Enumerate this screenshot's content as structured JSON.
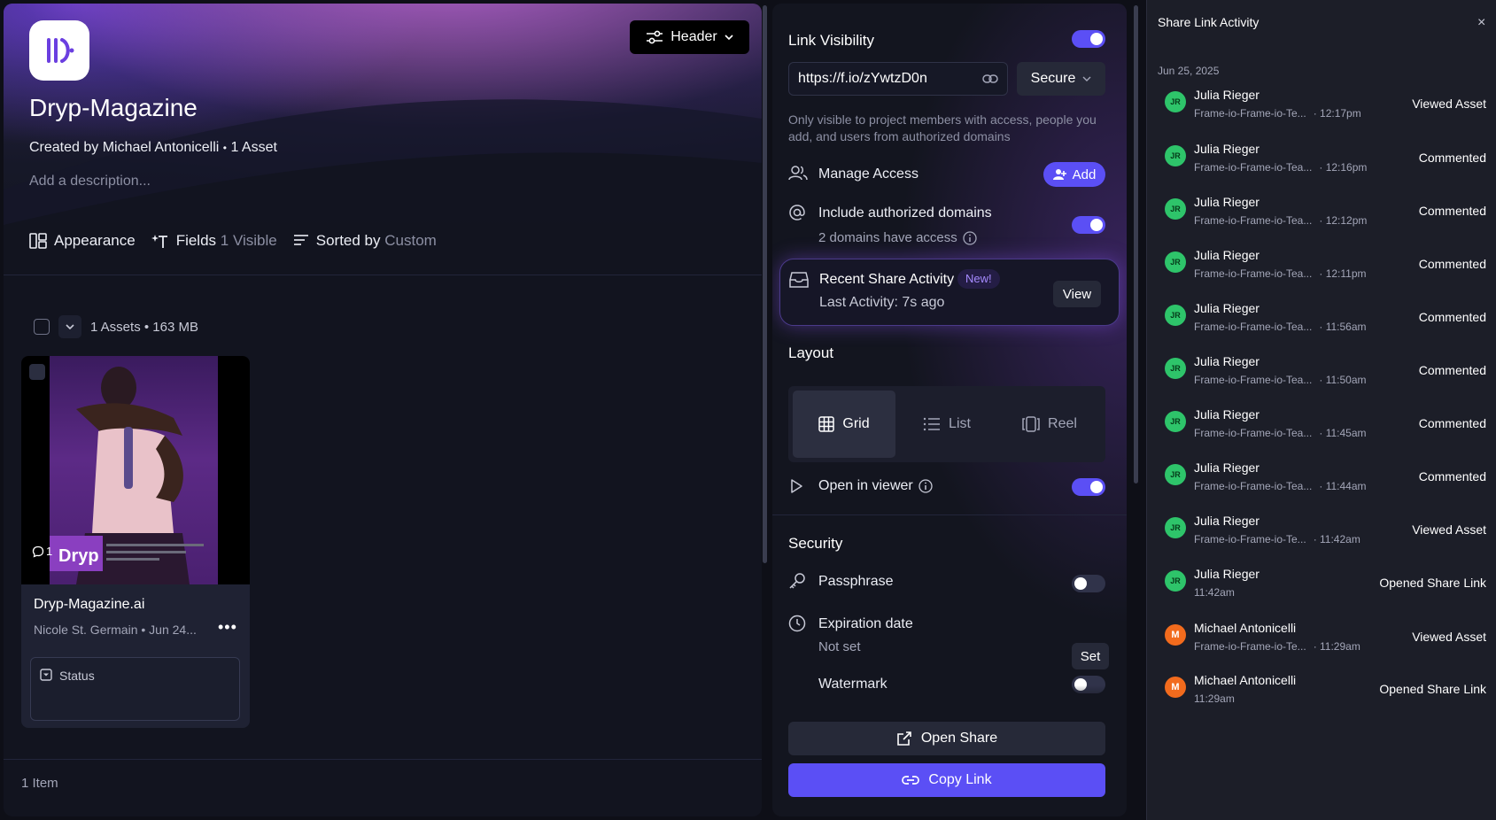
{
  "left": {
    "header_button": "Header",
    "project_title": "Dryp-Magazine",
    "created_by": "Created by Michael Antonicelli",
    "asset_count": "1 Asset",
    "description_placeholder": "Add a description...",
    "toolbar": {
      "appearance": "Appearance",
      "fields": "Fields",
      "fields_value": "1 Visible",
      "sorted": "Sorted by",
      "sorted_value": "Custom"
    },
    "assets_summary": "1 Assets • 163 MB",
    "card": {
      "comment_count": "1",
      "brand": "Dryp",
      "name": "Dryp-Magazine.ai",
      "meta": "Nicole St. Germain • Jun 24...",
      "more": "•••",
      "status_label": "Status"
    },
    "footer": "1 Item"
  },
  "share": {
    "link_visibility": "Link Visibility",
    "url": "https://f.io/zYwtzD0n",
    "secure": "Secure",
    "note": "Only visible to project members with access, people you add, and users from authorized domains",
    "manage_access": "Manage Access",
    "add": "Add",
    "include_domains": "Include authorized domains",
    "domains_have_access": "2 domains have access",
    "recent_activity": "Recent Share Activity",
    "new_badge": "New!",
    "last_activity": "Last Activity: 7s ago",
    "view": "View",
    "layout_title": "Layout",
    "layout_options": [
      "Grid",
      "List",
      "Reel"
    ],
    "open_in_viewer": "Open in viewer",
    "security_title": "Security",
    "passphrase": "Passphrase",
    "expiration_date": "Expiration date",
    "expiration_value": "Not set",
    "set": "Set",
    "watermark": "Watermark",
    "open_share": "Open Share",
    "copy_link": "Copy Link",
    "toggles": {
      "link_visibility": true,
      "include_domains": true,
      "open_in_viewer": true,
      "passphrase": false,
      "watermark": false
    }
  },
  "activity": {
    "title": "Share Link Activity",
    "close": "×",
    "date": "Jun 25, 2025",
    "items": [
      {
        "initials": "JR",
        "name": "Julia Rieger",
        "file": "Frame-io-Frame-io-Te...",
        "time": "· 12:17pm",
        "action": "Viewed Asset"
      },
      {
        "initials": "JR",
        "name": "Julia Rieger",
        "file": "Frame-io-Frame-io-Tea...",
        "time": "· 12:16pm",
        "action": "Commented"
      },
      {
        "initials": "JR",
        "name": "Julia Rieger",
        "file": "Frame-io-Frame-io-Tea...",
        "time": "· 12:12pm",
        "action": "Commented"
      },
      {
        "initials": "JR",
        "name": "Julia Rieger",
        "file": "Frame-io-Frame-io-Tea...",
        "time": "· 12:11pm",
        "action": "Commented"
      },
      {
        "initials": "JR",
        "name": "Julia Rieger",
        "file": "Frame-io-Frame-io-Tea...",
        "time": "· 11:56am",
        "action": "Commented"
      },
      {
        "initials": "JR",
        "name": "Julia Rieger",
        "file": "Frame-io-Frame-io-Tea...",
        "time": "· 11:50am",
        "action": "Commented"
      },
      {
        "initials": "JR",
        "name": "Julia Rieger",
        "file": "Frame-io-Frame-io-Tea...",
        "time": "· 11:45am",
        "action": "Commented"
      },
      {
        "initials": "JR",
        "name": "Julia Rieger",
        "file": "Frame-io-Frame-io-Tea...",
        "time": "· 11:44am",
        "action": "Commented"
      },
      {
        "initials": "JR",
        "name": "Julia Rieger",
        "file": "Frame-io-Frame-io-Te...",
        "time": "· 11:42am",
        "action": "Viewed Asset"
      },
      {
        "initials": "JR",
        "name": "Julia Rieger",
        "file": "11:42am",
        "time": "",
        "action": "Opened Share Link"
      },
      {
        "initials": "M",
        "name": "Michael Antonicelli",
        "file": "Frame-io-Frame-io-Te...",
        "time": "· 11:29am",
        "action": "Viewed Asset"
      },
      {
        "initials": "M",
        "name": "Michael Antonicelli",
        "file": "11:29am",
        "time": "",
        "action": "Opened Share Link"
      }
    ]
  },
  "colors": {
    "accent": "#5b4ff5",
    "avatar_green": "#2ec46a",
    "avatar_orange": "#f26b1d"
  }
}
